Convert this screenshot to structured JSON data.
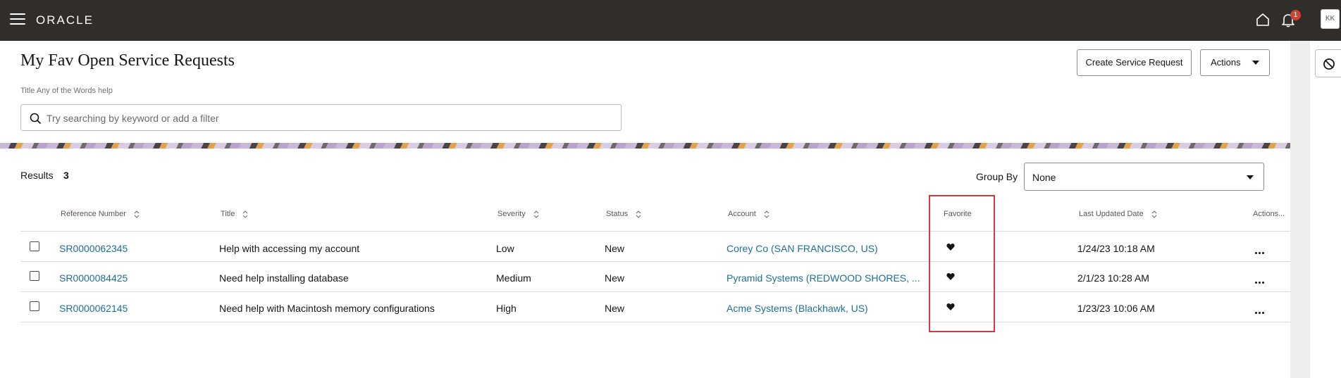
{
  "header": {
    "logo_text": "ORACLE",
    "notification_count": "1",
    "avatar_initials": "KK"
  },
  "page": {
    "title": "My Fav Open Service Requests",
    "search_help": "Title Any of the Words help",
    "search_placeholder": "Try searching by keyword or add a filter",
    "create_button": "Create Service Request",
    "actions_button": "Actions"
  },
  "results": {
    "label": "Results",
    "count": "3",
    "group_by_label": "Group By",
    "group_by_value": "None"
  },
  "table": {
    "columns": {
      "reference_number": "Reference Number",
      "title": "Title",
      "severity": "Severity",
      "status": "Status",
      "account": "Account",
      "favorite": "Favorite",
      "last_updated": "Last Updated Date",
      "actions": "Actions..."
    },
    "rows": [
      {
        "ref": "SR0000062345",
        "title": "Help with accessing my account",
        "severity": "Low",
        "status": "New",
        "account": "Corey Co (SAN FRANCISCO, US)",
        "updated": "1/24/23 10:18 AM"
      },
      {
        "ref": "SR0000084425",
        "title": "Need help installing database",
        "severity": "Medium",
        "status": "New",
        "account": "Pyramid Systems (REDWOOD SHORES, ...",
        "updated": "2/1/23 10:28 AM"
      },
      {
        "ref": "SR0000062145",
        "title": "Need help with Macintosh memory configurations",
        "severity": "High",
        "status": "New",
        "account": "Acme Systems (Blackhawk, US)",
        "updated": "1/23/23 10:06 AM"
      }
    ]
  },
  "colors": {
    "topbar": "#312d2a",
    "link": "#1e6f94",
    "badge": "#c74634",
    "highlight": "#d9363e"
  },
  "icons": [
    "hamburger-icon",
    "home-icon",
    "bell-icon",
    "search-icon",
    "block-icon",
    "heart-icon",
    "sort-icon",
    "more-icon",
    "chevron-down-icon"
  ]
}
